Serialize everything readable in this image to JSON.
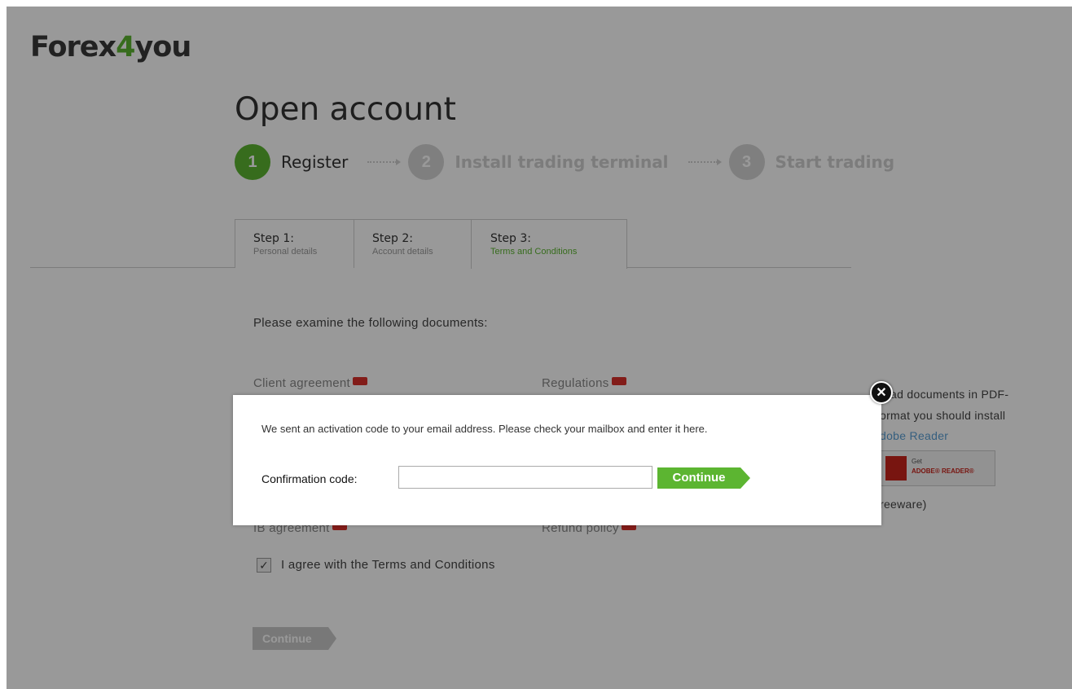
{
  "logo": {
    "part1": "Forex",
    "part2": "4",
    "part3": "you"
  },
  "page_title": "Open account",
  "progress": [
    {
      "num": "1",
      "label": "Register"
    },
    {
      "num": "2",
      "label": "Install trading terminal"
    },
    {
      "num": "3",
      "label": "Start trading"
    }
  ],
  "tabs": [
    {
      "title": "Step 1:",
      "subtitle": "Personal details"
    },
    {
      "title": "Step 2:",
      "subtitle": "Account details"
    },
    {
      "title": "Step 3:",
      "subtitle": "Terms and Conditions"
    }
  ],
  "instructions": "Please examine the following documents:",
  "documents": {
    "client_agreement": "Client agreement",
    "regulations": "Regulations",
    "ib_agreement": "IB agreement",
    "refund_policy": "Refund policy"
  },
  "sidebar": {
    "line1": "read documents in PDF-",
    "line2": "ormat you should install",
    "line3": "dobe Reader",
    "badge_get": "Get",
    "badge_reader": "ADOBE® READER®",
    "freeware": "reeware)"
  },
  "agree_label": "I agree with the Terms and Conditions",
  "agree_checked": true,
  "continue_label": "Continue",
  "modal": {
    "message": "We sent an activation code to your email address. Please check your mailbox and enter it here.",
    "code_label": "Confirmation code:",
    "code_value": "",
    "button_label": "Continue",
    "close_symbol": "✕"
  },
  "colors": {
    "brand_green": "#5cb531",
    "overlay": "rgba(0,0,0,0.4)"
  }
}
